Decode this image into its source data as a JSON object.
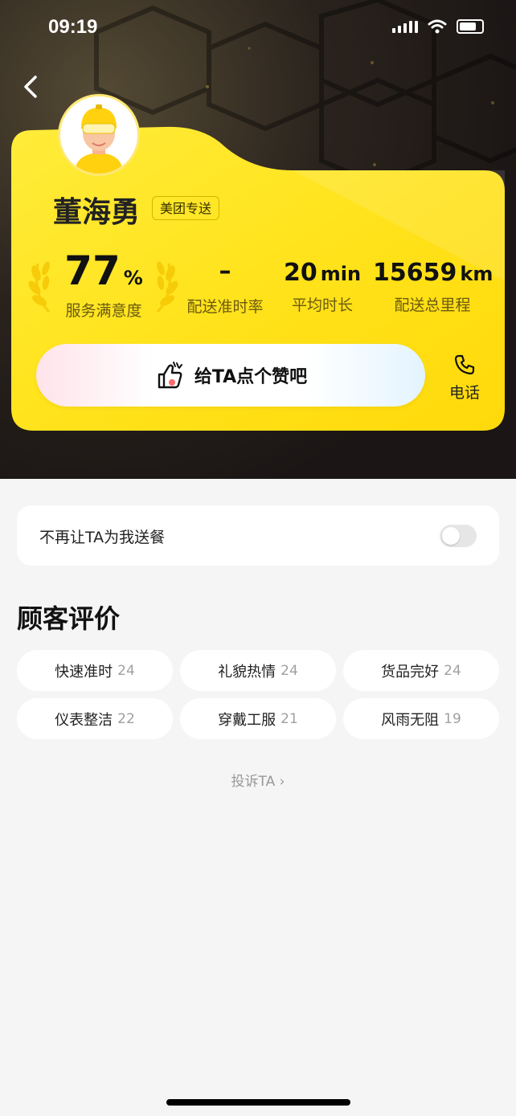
{
  "status_bar": {
    "time": "09:19"
  },
  "rider": {
    "name": "董海勇",
    "tag": "美团专送"
  },
  "stats": [
    {
      "value": "77",
      "unit": "%",
      "label": "服务满意度"
    },
    {
      "value": "–",
      "unit": "",
      "label": "配送准时率"
    },
    {
      "value": "20",
      "unit": "min",
      "label": "平均时长"
    },
    {
      "value": "15659",
      "unit": "km",
      "label": "配送总里程"
    }
  ],
  "actions": {
    "like_label": "给TA点个赞吧",
    "phone_label": "电话"
  },
  "settings": {
    "block_label": "不再让TA为我送餐",
    "block_enabled": false
  },
  "reviews": {
    "title": "顾客评价",
    "chips": [
      {
        "label": "快速准时",
        "count": "24"
      },
      {
        "label": "礼貌热情",
        "count": "24"
      },
      {
        "label": "货品完好",
        "count": "24"
      },
      {
        "label": "仪表整洁",
        "count": "22"
      },
      {
        "label": "穿戴工服",
        "count": "21"
      },
      {
        "label": "风雨无阻",
        "count": "19"
      }
    ]
  },
  "complain": {
    "label": "投诉TA ›"
  },
  "colors": {
    "card_yellow": "#ffe21a",
    "page_bg": "#f5f5f5"
  }
}
